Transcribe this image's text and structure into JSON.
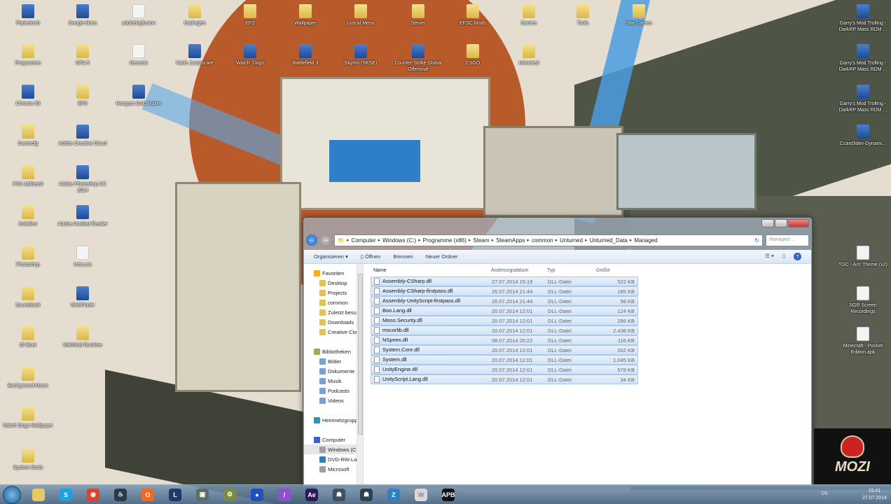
{
  "desktop": {
    "icon_columns": [
      {
        "items": [
          {
            "label": "Papierkorb",
            "kind": "app"
          },
          {
            "label": "Programme",
            "kind": "folder"
          },
          {
            "label": "Chrome 89",
            "kind": "app"
          },
          {
            "label": "Gamecfg",
            "kind": "folder"
          },
          {
            "label": "PS3 Jailbreak",
            "kind": "folder"
          },
          {
            "label": "Kolaflow",
            "kind": "folder"
          },
          {
            "label": "Photoshop",
            "kind": "folder"
          },
          {
            "label": "Soundtrack",
            "kind": "folder"
          },
          {
            "label": "GI Boot",
            "kind": "folder"
          },
          {
            "label": "Background Music",
            "kind": "folder"
          },
          {
            "label": "Watch Dogs Wallpaper",
            "kind": "folder"
          },
          {
            "label": "System Mods",
            "kind": "folder"
          }
        ]
      },
      {
        "items": [
          {
            "label": "Google Docs",
            "kind": "app"
          },
          {
            "label": "GTA 5",
            "kind": "folder"
          },
          {
            "label": "EFS",
            "kind": "folder"
          },
          {
            "label": "Adobe Creative Cloud",
            "kind": "app"
          },
          {
            "label": "Adobe Photoshop CC 2014",
            "kind": "app"
          },
          {
            "label": "Adobe Acrobat Reader",
            "kind": "app"
          },
          {
            "label": "Intro.avi",
            "kind": "file"
          },
          {
            "label": "WebFinder",
            "kind": "app"
          },
          {
            "label": "WebMod Runtime",
            "kind": "folder"
          }
        ]
      },
      {
        "items": [
          {
            "label": "adobelogfusion",
            "kind": "file"
          },
          {
            "label": "Genesis",
            "kind": "file"
          },
          {
            "label": "Hangout Gold Maker",
            "kind": "app"
          }
        ]
      },
      {
        "items": [
          {
            "label": "Cryfragen",
            "kind": "folder"
          },
          {
            "label": "Node Jumpscare",
            "kind": "app"
          }
        ]
      },
      {
        "items": [
          {
            "label": "EFS",
            "kind": "folder"
          },
          {
            "label": "Watch_Dogs",
            "kind": "app"
          }
        ]
      },
      {
        "items": [
          {
            "label": "Wallpaper",
            "kind": "folder"
          },
          {
            "label": "Battlefield 3",
            "kind": "app"
          }
        ]
      },
      {
        "items": [
          {
            "label": "Lyrical Menu",
            "kind": "folder"
          },
          {
            "label": "Skyrim (SKSE)",
            "kind": "app"
          }
        ]
      },
      {
        "items": [
          {
            "label": "Server",
            "kind": "folder"
          },
          {
            "label": "Counter-Strike Global Offensive",
            "kind": "app"
          }
        ]
      },
      {
        "items": [
          {
            "label": "EFSC Mods",
            "kind": "folder"
          },
          {
            "label": "CSGO",
            "kind": "folder"
          }
        ]
      },
      {
        "items": [
          {
            "label": "Games",
            "kind": "folder"
          },
          {
            "label": "Unturned",
            "kind": "folder"
          }
        ]
      },
      {
        "items": [
          {
            "label": "Tools",
            "kind": "folder"
          }
        ]
      },
      {
        "items": [
          {
            "label": "Star Games",
            "kind": "folder"
          }
        ]
      }
    ],
    "right_icons": [
      {
        "label": "Garry's Mod Trolling - DarkRP Mass RDM ...",
        "kind": "app"
      },
      {
        "label": "Garry's Mod Trolling - DarkRP Mass RDM ...",
        "kind": "app"
      },
      {
        "label": "Garry's Mod Trolling - DarkRP Mass RDM ...",
        "kind": "app"
      },
      {
        "label": "Ccard3dev-Dynami...",
        "kind": "app"
      }
    ],
    "right_files": [
      {
        "label": "TGC - Arrr Theme (v2) ...",
        "kind": "file"
      },
      {
        "label": "SGR Screen Recordings",
        "kind": "file"
      },
      {
        "label": "Minecraft - Pocket Edition.apk",
        "kind": "file"
      }
    ]
  },
  "explorer": {
    "breadcrumb": [
      "Computer",
      "Windows (C:)",
      "Programme (x86)",
      "Steam",
      "SteamApps",
      "common",
      "Unturned",
      "Unturned_Data",
      "Managed"
    ],
    "search_placeholder": "Managed ...",
    "toolbar": {
      "organize": "Organisieren ▾",
      "open": "Öffnen",
      "burn": "Brennen",
      "new_folder": "Neuer Ordner"
    },
    "nav": {
      "favorites": {
        "label": "Favoriten",
        "items": [
          "Desktop",
          "Projects",
          "common",
          "Zuletzt besucht",
          "Downloads",
          "Creative Cloud"
        ]
      },
      "libraries": {
        "label": "Bibliotheken",
        "items": [
          "Bilder",
          "Dokumente",
          "Musik",
          "Podcasts",
          "Videos"
        ]
      },
      "homegroup": "Heimnetzgruppe",
      "computer": {
        "label": "Computer",
        "items": [
          "Windows (C:)",
          "DVD-RW-Laufwerk",
          "Microsoft"
        ]
      }
    },
    "columns": {
      "name": "Name",
      "date": "Änderungsdatum",
      "type": "Typ",
      "size": "Größe"
    },
    "files": [
      {
        "name": "Assembly-CSharp.dll",
        "date": "27.07.2014 15:19",
        "type": "DLL-Datei",
        "size": "522 KB"
      },
      {
        "name": "Assembly-CSharp-firstpass.dll",
        "date": "26.07.2014 21:44",
        "type": "DLL-Datei",
        "size": "185 KB"
      },
      {
        "name": "Assembly-UnityScript-firstpass.dll",
        "date": "26.07.2014 21:44",
        "type": "DLL-Datei",
        "size": "58 KB"
      },
      {
        "name": "Boo.Lang.dll",
        "date": "20.07.2014 12:01",
        "type": "DLL-Datei",
        "size": "124 KB"
      },
      {
        "name": "Mono.Security.dll",
        "date": "20.07.2014 12:01",
        "type": "DLL-Datei",
        "size": "286 KB"
      },
      {
        "name": "mscorlib.dll",
        "date": "20.07.2014 12:01",
        "type": "DLL-Datei",
        "size": "2.438 KB"
      },
      {
        "name": "NSpeex.dll",
        "date": "08.07.2014 20:22",
        "type": "DLL-Datei",
        "size": "116 KB"
      },
      {
        "name": "System.Core.dll",
        "date": "20.07.2014 12:01",
        "type": "DLL-Datei",
        "size": "262 KB"
      },
      {
        "name": "System.dll",
        "date": "20.07.2014 12:01",
        "type": "DLL-Datei",
        "size": "1.045 KB"
      },
      {
        "name": "UnityEngine.dll",
        "date": "20.07.2014 12:01",
        "type": "DLL-Datei",
        "size": "578 KB"
      },
      {
        "name": "UnityScript.Lang.dll",
        "date": "20.07.2014 12:01",
        "type": "DLL-Datei",
        "size": "34 KB"
      }
    ]
  },
  "taskbar": {
    "apps": [
      {
        "name": "explorer",
        "glyph": "",
        "color": "#e8c860"
      },
      {
        "name": "skype",
        "glyph": "S",
        "color": "#1aa1e0"
      },
      {
        "name": "chrome",
        "glyph": "◉",
        "color": "#d9442f"
      },
      {
        "name": "steam",
        "glyph": "♨",
        "color": "#2a3a4a"
      },
      {
        "name": "origin",
        "glyph": "O",
        "color": "#f06a22"
      },
      {
        "name": "league-of-legends",
        "glyph": "L",
        "color": "#1c3a66"
      },
      {
        "name": "media-app",
        "glyph": "▣",
        "color": "#5a7060"
      },
      {
        "name": "tool-app",
        "glyph": "⚙",
        "color": "#7a8a40"
      },
      {
        "name": "blue-orb-app",
        "glyph": "●",
        "color": "#2050c0"
      },
      {
        "name": "feather-app",
        "glyph": "/",
        "color": "#9050d0"
      },
      {
        "name": "after-effects",
        "glyph": "Ae",
        "color": "#2a1a5a"
      },
      {
        "name": "game-1",
        "glyph": "☗",
        "color": "#405060"
      },
      {
        "name": "game-2",
        "glyph": "☗",
        "color": "#304050"
      },
      {
        "name": "game-3",
        "glyph": "Z",
        "color": "#3080c0"
      },
      {
        "name": "word-app",
        "glyph": "W",
        "color": "#d8d8d8"
      },
      {
        "name": "apb",
        "glyph": "APB",
        "color": "#111111"
      }
    ],
    "lang": "DE",
    "time": "15:41",
    "date": "27.07.2014"
  },
  "watermark": {
    "text": "MOZI"
  }
}
